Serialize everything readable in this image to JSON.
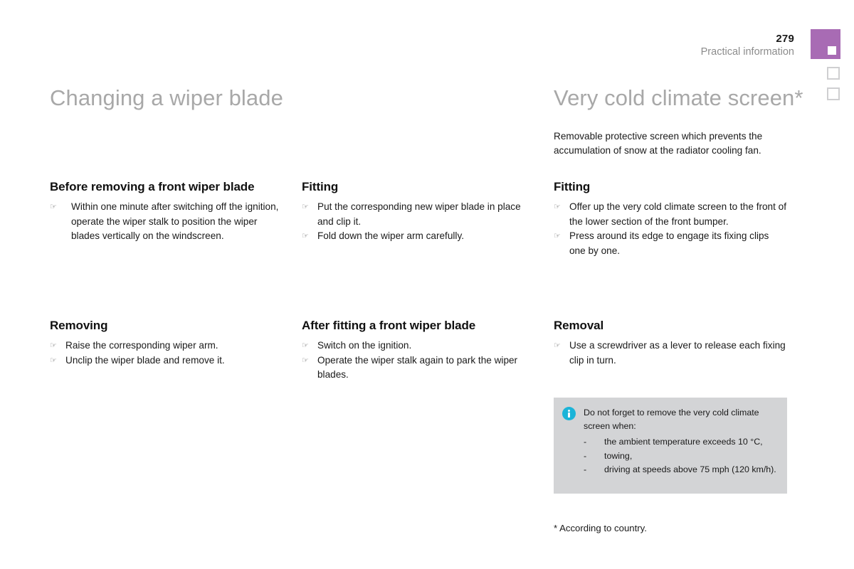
{
  "header": {
    "page_number": "279",
    "section_name": "Practical information",
    "tab_icon": "active-chapter-tab"
  },
  "left_column": {
    "title": "Changing a wiper blade",
    "sections": [
      {
        "heading": "Before removing a front wiper blade",
        "items": [
          "Within one minute after switching off the ignition, operate the wiper stalk to position the wiper blades vertically on the windscreen."
        ]
      },
      {
        "heading": "Removing",
        "items": [
          "Raise the corresponding wiper arm.",
          "Unclip the wiper blade and remove it."
        ]
      }
    ]
  },
  "middle_column": {
    "sections": [
      {
        "heading": "Fitting",
        "items": [
          "Put the corresponding new wiper blade in place and clip it.",
          "Fold down the wiper arm carefully."
        ]
      },
      {
        "heading": "After fitting a front wiper blade",
        "items": [
          "Switch on the ignition.",
          "Operate the wiper stalk again to park the wiper blades."
        ]
      }
    ]
  },
  "right_column": {
    "title": "Very cold climate screen*",
    "intro": "Removable protective screen which prevents the accumulation of snow at the radiator cooling fan.",
    "sections": [
      {
        "heading": "Fitting",
        "items": [
          "Offer up the very cold climate screen to the front of the lower section of the front bumper.",
          "Press around its edge to engage its fixing clips one by one."
        ]
      },
      {
        "heading": "Removal",
        "items": [
          "Use a screwdriver as a lever to release each fixing clip in turn."
        ]
      }
    ],
    "info_box": {
      "icon": "info-icon",
      "text": "Do not forget to remove the very cold climate screen when:",
      "dash": "-",
      "conditions": [
        "the ambient temperature exceeds 10 °C,",
        "towing,",
        "driving at speeds above 75 mph (120 km/h)."
      ]
    },
    "footnote": "* According to country."
  },
  "bullet_glyph": "☞",
  "colors": {
    "tab_purple": "#a86bb4",
    "title_grey": "#a8a8a8",
    "info_box_bg": "#d3d4d6",
    "info_icon_cyan": "#1bb4d8",
    "section_name_grey": "#8c8c8c"
  }
}
